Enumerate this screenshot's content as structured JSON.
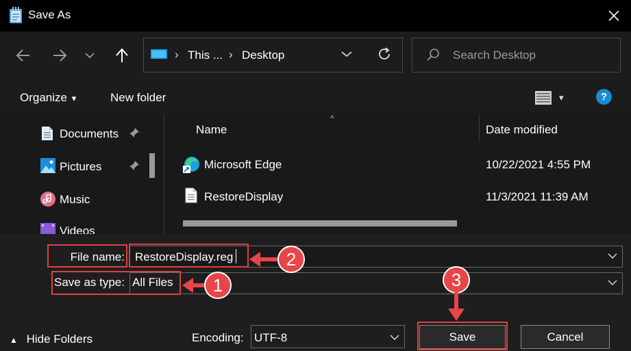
{
  "window": {
    "title": "Save As",
    "title_icon": "notepad-icon",
    "close_icon": "close-icon"
  },
  "navigation": {
    "back_icon": "arrow-left-icon",
    "forward_icon": "arrow-right-icon",
    "recent_icon": "chevron-down-icon",
    "up_icon": "arrow-up-icon",
    "address": {
      "location_icon": "monitor-icon",
      "breadcrumbs": [
        "This ...",
        "Desktop"
      ],
      "separator": "›",
      "dropdown_icon": "chevron-down-icon",
      "refresh_icon": "refresh-icon"
    },
    "search": {
      "placeholder": "Search Desktop",
      "icon": "search-icon"
    }
  },
  "toolbar": {
    "organize_label": "Organize",
    "organize_caret": "▾",
    "new_folder_label": "New folder",
    "view_icon": "details-view-icon",
    "view_caret": "▾",
    "help_label": "?"
  },
  "nav_pane": {
    "items": [
      {
        "label": "Documents",
        "icon": "documents-icon",
        "pinned": true
      },
      {
        "label": "Pictures",
        "icon": "pictures-icon",
        "pinned": true
      },
      {
        "label": "Music",
        "icon": "music-icon",
        "pinned": false
      },
      {
        "label": "Videos",
        "icon": "videos-icon",
        "pinned": false
      }
    ]
  },
  "file_list": {
    "sort_indicator": "^",
    "columns": {
      "name": "Name",
      "date_modified": "Date modified"
    },
    "rows": [
      {
        "name": "Microsoft Edge",
        "icon": "edge-shortcut-icon",
        "date": "10/22/2021 4:55 PM"
      },
      {
        "name": "RestoreDisplay",
        "icon": "text-file-icon",
        "date": "11/3/2021 11:39 AM"
      }
    ]
  },
  "form": {
    "file_name_label": "File name:",
    "file_name_value": "RestoreDisplay.reg",
    "save_as_type_label": "Save as type:",
    "save_as_type_value": "All Files",
    "encoding_label": "Encoding:",
    "encoding_value": "UTF-8"
  },
  "footer": {
    "hide_folders_label": "Hide Folders",
    "hide_folders_caret": "▲",
    "save_label": "Save",
    "cancel_label": "Cancel"
  },
  "annotations": {
    "step_1": "1",
    "step_2": "2",
    "step_3": "3",
    "color": "#e8454a"
  },
  "colors": {
    "title_bar": "#000000",
    "window_bg": "#1c1c1c",
    "accent": "#1a8ad4"
  }
}
